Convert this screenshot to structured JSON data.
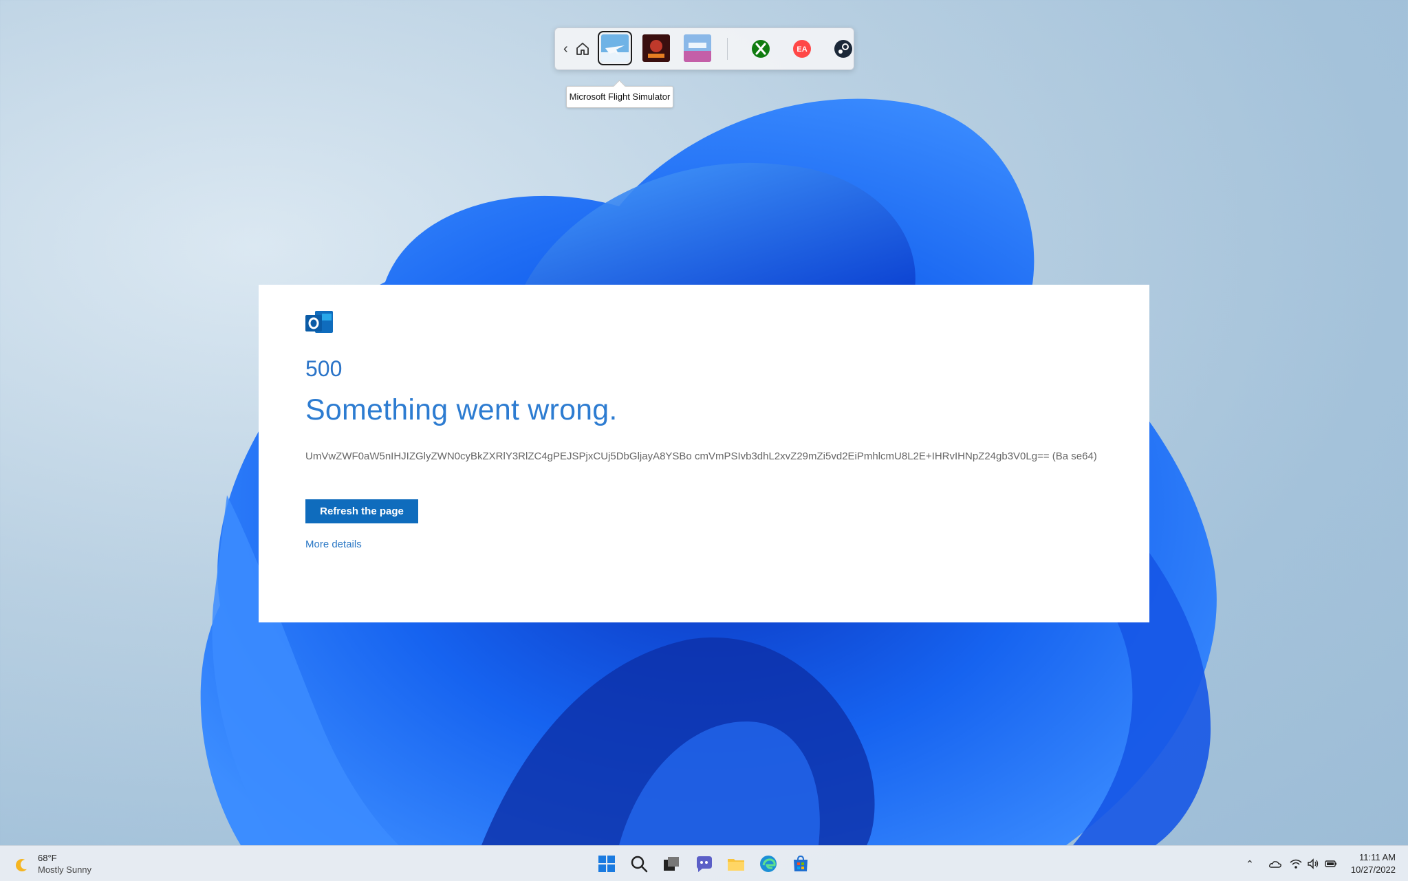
{
  "gamebar": {
    "tooltip": "Microsoft Flight Simulator",
    "games": [
      "Microsoft Flight Simulator",
      "game-thumbnail-2",
      "Forza Horizon"
    ],
    "launchers": [
      "xbox-icon",
      "ea-icon",
      "steam-icon"
    ]
  },
  "error": {
    "code": "500",
    "title": "Something went wrong.",
    "detail": "UmVwZWF0aW5nIHJIZGlyZWN0cyBkZXRlY3RlZC4gPEJSPjxCUj5DbGljayA8YSBo cmVmPSIvb3dhL2xvZ29mZi5vd2EiPmhlcmU8L2E+IHRvIHNpZ24gb3V0Lg== (Ba se64)",
    "refresh_label": "Refresh the page",
    "more_label": "More details"
  },
  "taskbar": {
    "weather_temp": "68°F",
    "weather_desc": "Mostly Sunny",
    "time": "11:11 AM",
    "date": "10/27/2022"
  },
  "colors": {
    "accent": "#0f6cbd",
    "error_text": "#2d7cd1"
  }
}
